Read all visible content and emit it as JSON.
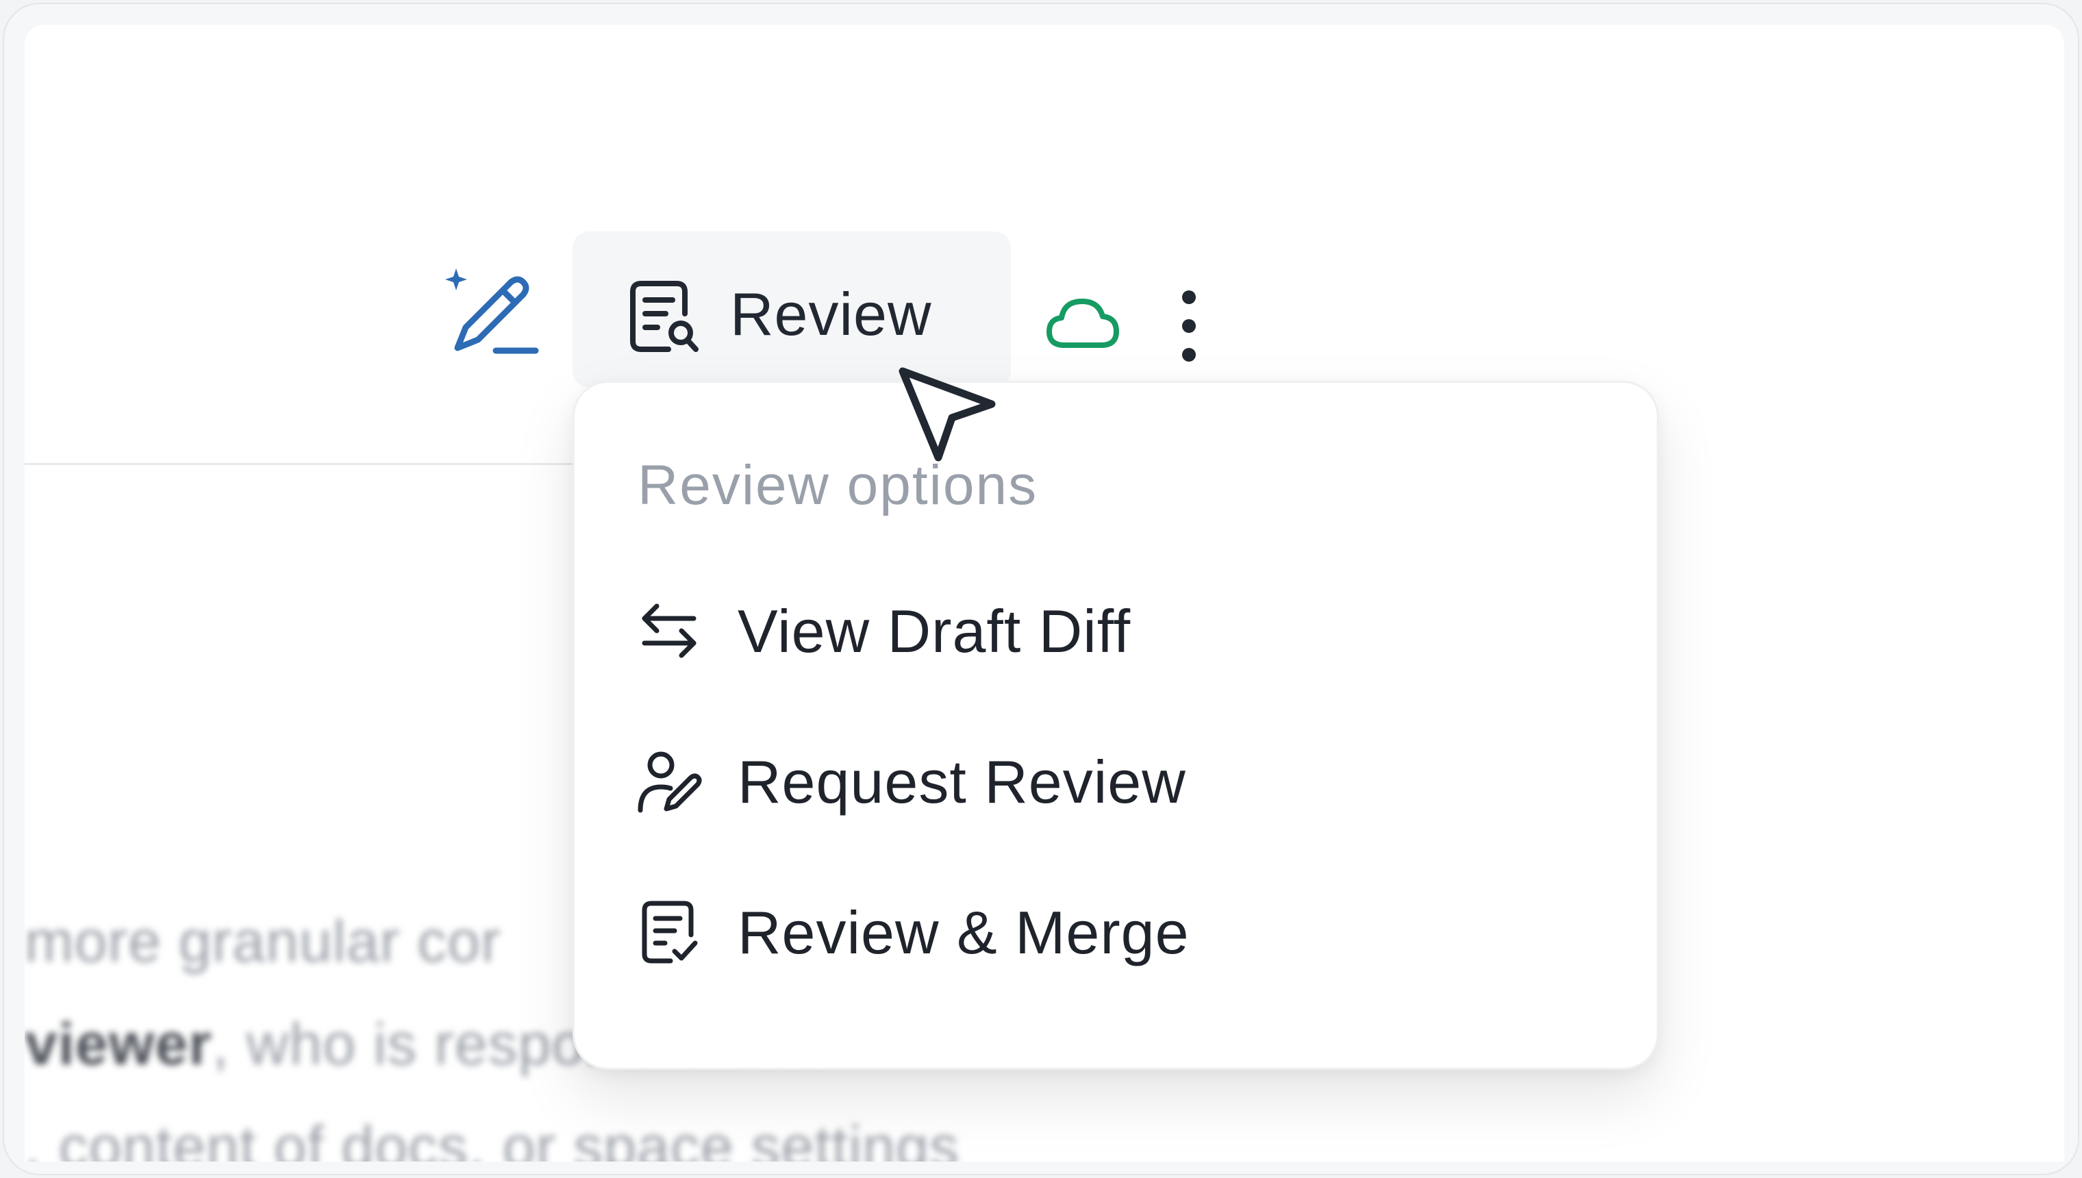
{
  "toolbar": {
    "review_label": "Review",
    "icons": {
      "edit": "ai-edit-pencil-icon",
      "review": "document-search-icon",
      "sync": "cloud-icon",
      "more": "more-vertical-icon"
    },
    "colors": {
      "edit_icon": "#2d6cb5",
      "sync_icon": "#169b62",
      "text": "#222831"
    }
  },
  "review_menu": {
    "title": "Review options",
    "items": [
      {
        "label": "View Draft Diff",
        "icon": "arrows-swap-icon"
      },
      {
        "label": "Request Review",
        "icon": "user-edit-icon"
      },
      {
        "label": "Review & Merge",
        "icon": "document-check-icon"
      }
    ]
  },
  "background": {
    "line1": "more granular cor",
    "line2_bold": "viewer",
    "line2_rest": ", who is responsible for",
    "line3": ", content of docs, or space settings"
  }
}
